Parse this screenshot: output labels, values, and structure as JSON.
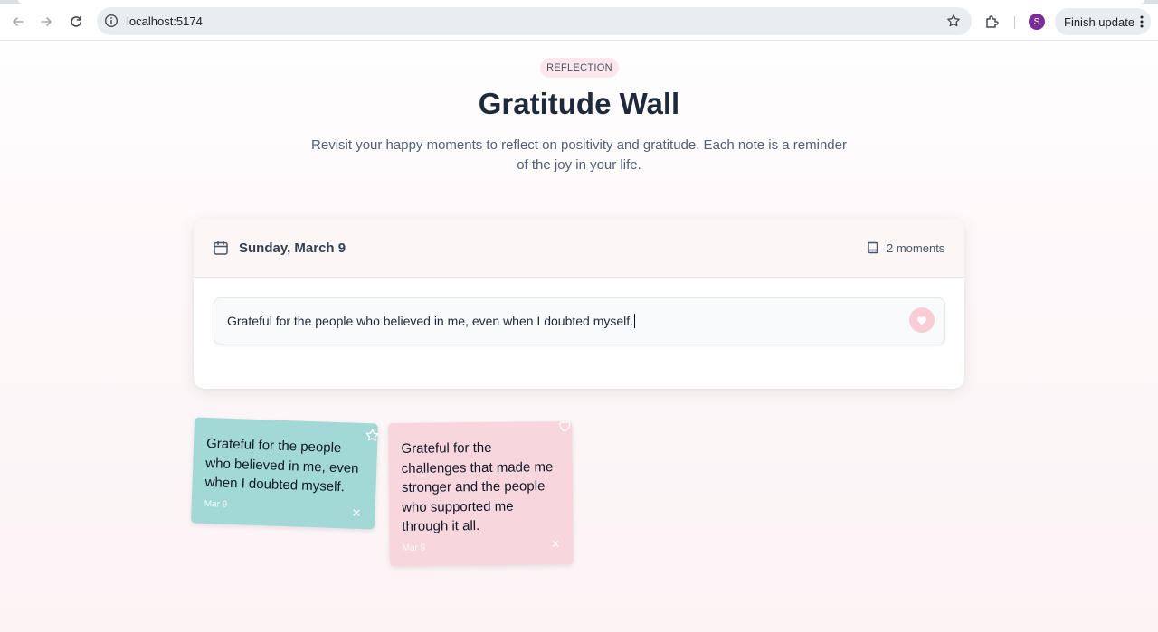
{
  "browser": {
    "url": "localhost:5174",
    "profile_initial": "S",
    "update_label": "Finish update"
  },
  "header": {
    "badge": "REFLECTION",
    "title": "Gratitude Wall",
    "subtitle": "Revisit your happy moments to reflect on positivity and gratitude. Each note is a reminder of the joy in your life."
  },
  "card": {
    "date": "Sunday, March 9",
    "moments": "2 moments",
    "input_value": "Grateful for the people who believed in me, even when I doubted myself."
  },
  "notes": [
    {
      "text": "Grateful for the people who believed in me, even when I doubted myself.",
      "date": "Mar 9",
      "color": "#a2d9d6",
      "corner_icon": "star-icon"
    },
    {
      "text": "Grateful for the challenges that made me stronger and the people who supported me through it all.",
      "date": "Mar 9",
      "color": "#f8d6dd",
      "corner_icon": "heart-icon"
    }
  ],
  "colors": {
    "accent_pink": "#f8cdd6",
    "title": "#1e293b",
    "badge_bg": "#fde7ec"
  }
}
